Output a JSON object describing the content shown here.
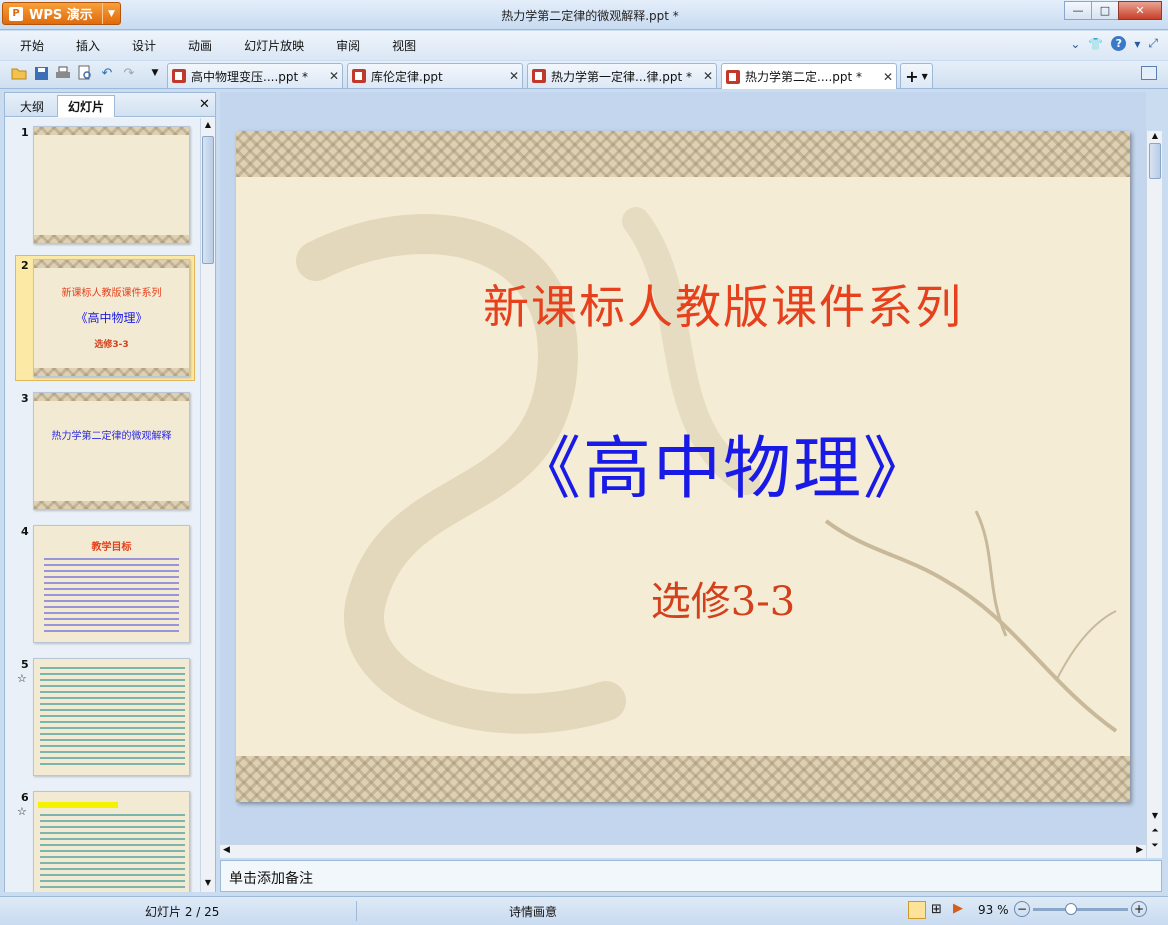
{
  "app": {
    "logo_glyph": "P",
    "name": "WPS 演示",
    "dropdown_icon": "dropdown-arrow-icon"
  },
  "window": {
    "title": "热力学第二定律的微观解释.ppt *",
    "min": "—",
    "max": "□",
    "close": "✕"
  },
  "menu": {
    "items": [
      "开始",
      "插入",
      "设计",
      "动画",
      "幻灯片放映",
      "审阅",
      "视图"
    ],
    "help": "?"
  },
  "toolbar": {
    "icons": [
      "open-folder-icon",
      "save-icon",
      "print-icon",
      "print-preview-icon",
      "undo-icon",
      "redo-icon",
      "customize-icon"
    ]
  },
  "tabs": [
    {
      "label": "高中物理变压....ppt *",
      "close": "✕"
    },
    {
      "label": "库伦定律.ppt",
      "close": "✕"
    },
    {
      "label": "热力学第一定律...律.ppt *",
      "close": "✕"
    },
    {
      "label": "热力学第二定....ppt *",
      "close": "✕",
      "active": true
    }
  ],
  "new_tab": "+",
  "panel": {
    "tab_outline": "大纲",
    "tab_slides": "幻灯片",
    "close": "✕"
  },
  "thumbnails": [
    {
      "num": "1"
    },
    {
      "num": "2",
      "line1": "新课标人教版课件系列",
      "line2": "《高中物理》",
      "line3": "选修3-3"
    },
    {
      "num": "3",
      "title": "热力学第二定律的微观解释"
    },
    {
      "num": "4",
      "title": "教学目标"
    },
    {
      "num": "5",
      "anim": "☆"
    },
    {
      "num": "6",
      "anim": "☆"
    }
  ],
  "slide": {
    "line1": "新课标人教版课件系列",
    "line2": "《高中物理》",
    "line3": "选修3-3"
  },
  "notes_placeholder": "单击添加备注",
  "status": {
    "slide_counter": "幻灯片 2 / 25",
    "theme": "诗情画意",
    "zoom": "93 %",
    "zoom_out": "−",
    "zoom_in": "+",
    "zoom_level": 0.4
  }
}
